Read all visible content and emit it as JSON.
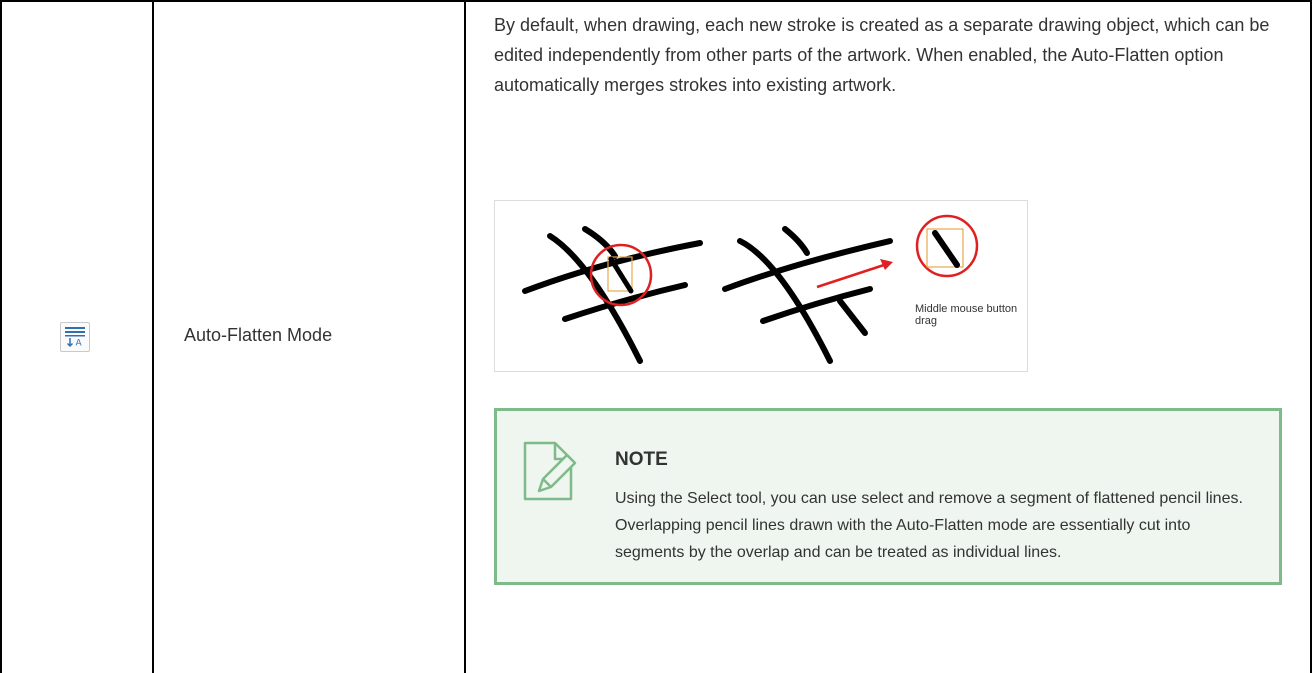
{
  "tool": {
    "icon": "auto-flatten-icon",
    "name": "Auto-Flatten Mode"
  },
  "description": "By default, when drawing, each new stroke is created as a separate drawing object, which can be edited independently from other parts of the artwork. When enabled, the Auto-Flatten option automatically merges strokes into existing artwork.",
  "figure": {
    "caption": "Middle mouse button drag",
    "colors": {
      "stroke": "#000000",
      "highlight": "#e02020",
      "selection": "#e8a84a"
    }
  },
  "note": {
    "icon": "note-pencil-icon",
    "title": "NOTE",
    "body": "Using the Select tool, you can use select and remove a segment of flattened pencil lines. Overlapping pencil lines drawn with the Auto-Flatten mode are essentially cut into segments by the overlap and can be treated as individual lines.",
    "colors": {
      "border": "#7fba8a",
      "background": "#eef6ef"
    }
  }
}
